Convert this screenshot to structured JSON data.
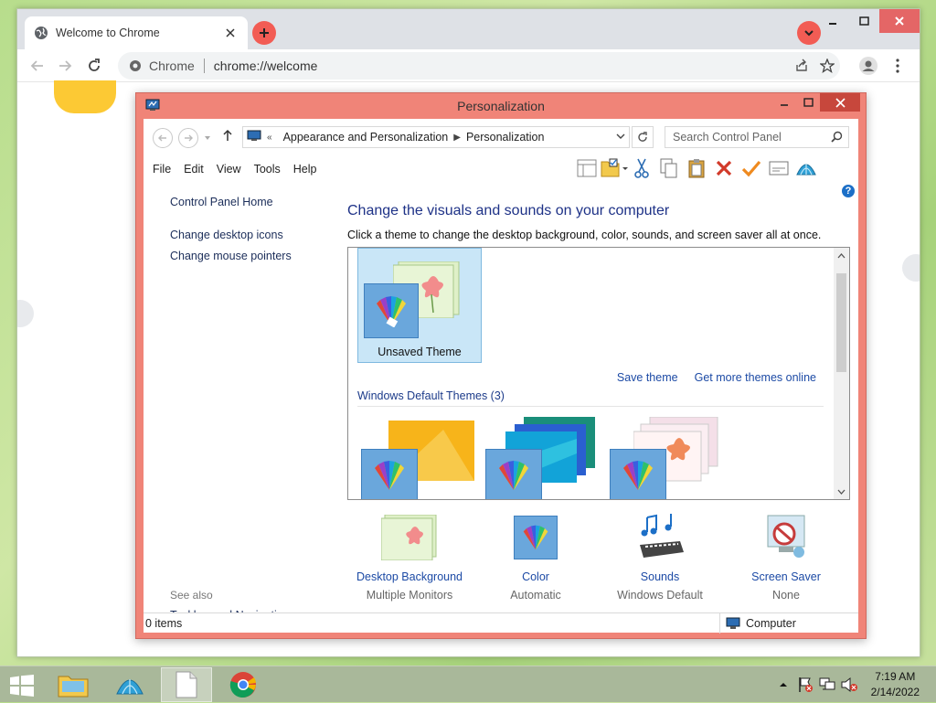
{
  "chrome": {
    "tab_title": "Welcome to Chrome",
    "site_chip": "Chrome",
    "url": "chrome://welcome"
  },
  "personalization": {
    "title": "Personalization",
    "breadcrumb": [
      "Appearance and Personalization",
      "Personalization"
    ],
    "breadcrumb_prefix": "«",
    "search_placeholder": "Search Control Panel",
    "menu": [
      "File",
      "Edit",
      "View",
      "Tools",
      "Help"
    ],
    "sidebar": {
      "home": "Control Panel Home",
      "links": [
        "Change desktop icons",
        "Change mouse pointers"
      ],
      "see_also_label": "See also",
      "see_also_links": [
        "Taskbar and Navigation"
      ]
    },
    "heading": "Change the visuals and sounds on your computer",
    "subheading": "Click a theme to change the desktop background, color, sounds, and screen saver all at once.",
    "selected_theme": "Unsaved Theme",
    "save_theme": "Save theme",
    "get_more_themes": "Get more themes online",
    "default_group": "Windows Default Themes (3)",
    "bottom_items": [
      {
        "label": "Desktop Background",
        "value": "Multiple Monitors"
      },
      {
        "label": "Color",
        "value": "Automatic"
      },
      {
        "label": "Sounds",
        "value": "Windows Default"
      },
      {
        "label": "Screen Saver",
        "value": "None"
      }
    ],
    "status_items": "0 items",
    "status_zone": "Computer"
  },
  "taskbar": {
    "time": "7:19 AM",
    "date": "2/14/2022"
  },
  "colors": {
    "window_frame": "#f08478",
    "accent_blue": "#1e3287",
    "link_blue": "#1c4aa5",
    "chrome_red": "#f25c54",
    "taskbar": "#a9b89a"
  }
}
